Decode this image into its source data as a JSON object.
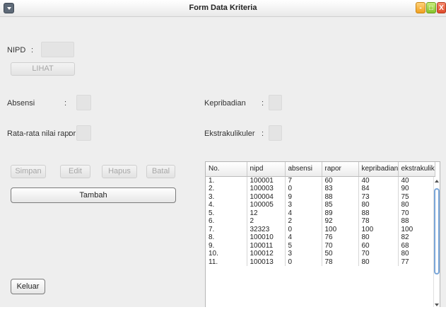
{
  "window": {
    "title": "Form Data Kriteria",
    "controls": {
      "min": "-",
      "max": "□",
      "close": "X"
    }
  },
  "form": {
    "nipd_label": "NIPD",
    "colon": ":",
    "lihat_button": "LIHAT",
    "absensi_label": "Absensi",
    "rapor_label": "Rata-rata nilai rapor",
    "kepribadian_label": "Kepribadian",
    "ekstra_label": "Ekstrakulikuler",
    "nipd_value": "",
    "absensi_value": "",
    "rapor_value": "",
    "kepribadian_value": "",
    "ekstra_value": ""
  },
  "buttons": {
    "simpan": "Simpan",
    "edit": "Edit",
    "hapus": "Hapus",
    "batal": "Batal",
    "tambah": "Tambah",
    "keluar": "Keluar"
  },
  "table": {
    "columns": [
      "No.",
      "nipd",
      "absensi",
      "rapor",
      "kepribadian",
      "ekstrakulik..."
    ],
    "rows": [
      [
        "1.",
        "100001",
        "7",
        "60",
        "40",
        "40"
      ],
      [
        "2.",
        "100003",
        "0",
        "83",
        "84",
        "90"
      ],
      [
        "3.",
        "100004",
        "9",
        "88",
        "73",
        "75"
      ],
      [
        "4.",
        "100005",
        "3",
        "85",
        "80",
        "80"
      ],
      [
        "5.",
        "12",
        "4",
        "89",
        "88",
        "70"
      ],
      [
        "6.",
        "2",
        "2",
        "92",
        "78",
        "88"
      ],
      [
        "7.",
        "32323",
        "0",
        "100",
        "100",
        "100"
      ],
      [
        "8.",
        "100010",
        "4",
        "76",
        "80",
        "82"
      ],
      [
        "9.",
        "100011",
        "5",
        "70",
        "60",
        "68"
      ],
      [
        "10.",
        "100012",
        "3",
        "50",
        "70",
        "80"
      ],
      [
        "11.",
        "100013",
        "0",
        "78",
        "80",
        "77"
      ]
    ]
  },
  "colors": {
    "panel": "#eeeeee",
    "scroll_thumb": "#7aa6d8",
    "close": "#e04a2a",
    "minimize": "#f0a020",
    "maximize": "#84c22a"
  }
}
